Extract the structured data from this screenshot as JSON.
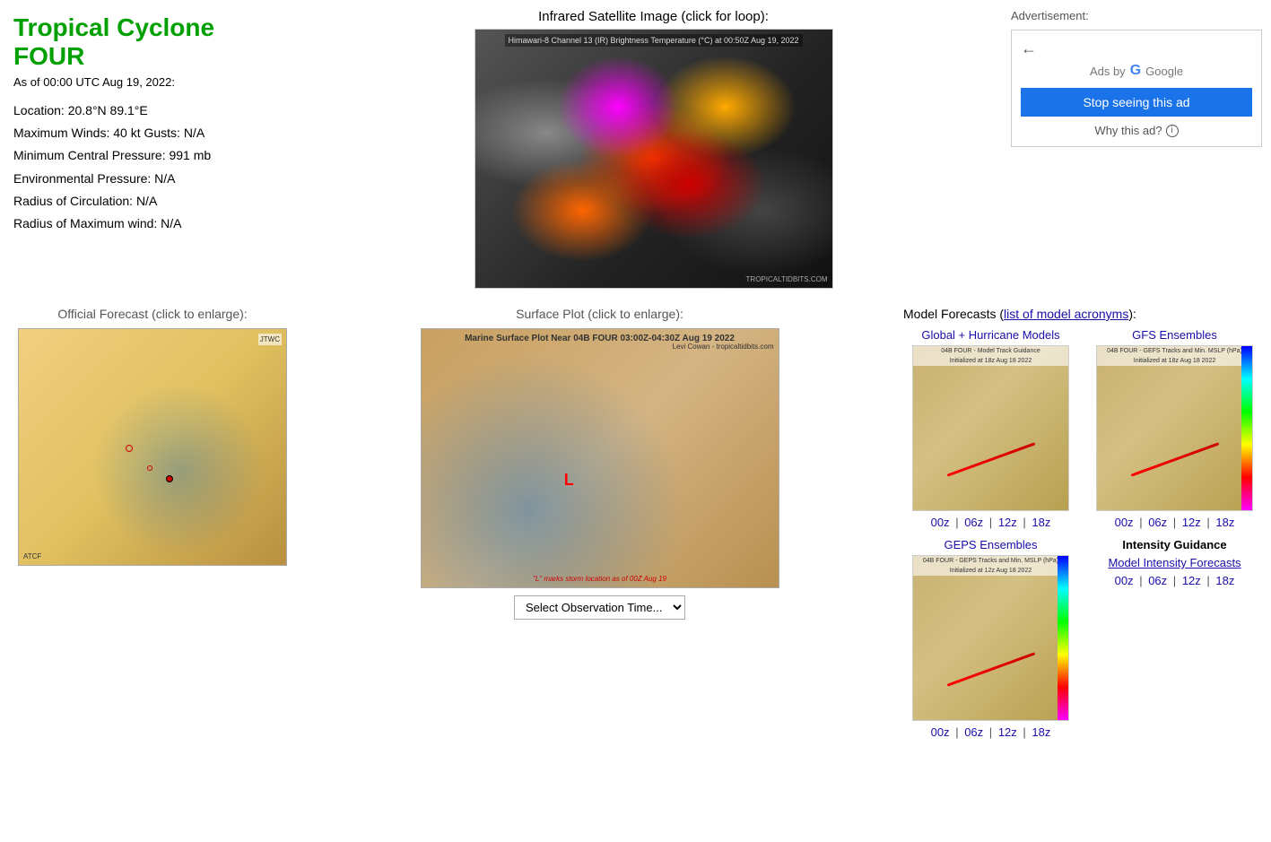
{
  "page": {
    "title": "Tropical Cyclone FOUR",
    "date": "As of 00:00 UTC Aug 19, 2022:",
    "location": "Location: 20.8°N 89.1°E",
    "max_winds": "Maximum Winds: 40 kt  Gusts: N/A",
    "min_pressure": "Minimum Central Pressure: 991 mb",
    "env_pressure": "Environmental Pressure: N/A",
    "radius_circulation": "Radius of Circulation: N/A",
    "radius_max_wind": "Radius of Maximum wind: N/A"
  },
  "satellite": {
    "title": "Infrared Satellite Image (click for loop):",
    "label": "Himawari-8 Channel 13 (IR) Brightness Temperature (°C) at 00:50Z Aug 19, 2022",
    "watermark": "TROPICALTIDBITS.COM"
  },
  "advertisement": {
    "title": "Advertisement:",
    "ads_by": "Ads by",
    "google": "Google",
    "stop_ad_button": "Stop seeing this ad",
    "why_ad": "Why this ad?"
  },
  "forecast": {
    "title": "Official Forecast (click to enlarge):"
  },
  "surface_plot": {
    "title": "Surface Plot (click to enlarge):",
    "label": "Marine Surface Plot Near 04B FOUR 03:00Z-04:30Z Aug 19 2022",
    "author": "Levi Cowan - tropicaltidbits.com",
    "select_label": "Select Observation Time...",
    "storm_marker": "L"
  },
  "model_forecasts": {
    "title": "Model Forecasts (",
    "link_text": "list of model acronyms",
    "title_end": "):",
    "sections": {
      "global_hurricane": {
        "title": "Global + Hurricane Models",
        "time_links": [
          "00z",
          "06z",
          "12z",
          "18z"
        ]
      },
      "gfs_ensembles": {
        "title": "GFS Ensembles",
        "time_links": [
          "00z",
          "06z",
          "12z",
          "18z"
        ]
      },
      "geps_ensembles": {
        "title": "GEPS Ensembles",
        "time_links": [
          "00z",
          "06z",
          "12z",
          "18z"
        ]
      },
      "intensity_guidance": {
        "title": "Intensity Guidance",
        "link": "Model Intensity Forecasts",
        "time_links": [
          "00z",
          "06z",
          "12z",
          "18z"
        ]
      }
    }
  },
  "model_img_labels": {
    "global": "04B FOUR - Model Track Guidance",
    "global_init": "Initialized at 18z Aug 18 2022",
    "gfs": "04B FOUR - GEFS Tracks and Min. MSLP (hPa)",
    "gfs_init": "Initialized at 18z Aug 18 2022",
    "geps": "04B FOUR - GEPS Tracks and Min. MSLP (hPa)",
    "geps_init": "Initialized at 12z Aug 18 2022"
  }
}
